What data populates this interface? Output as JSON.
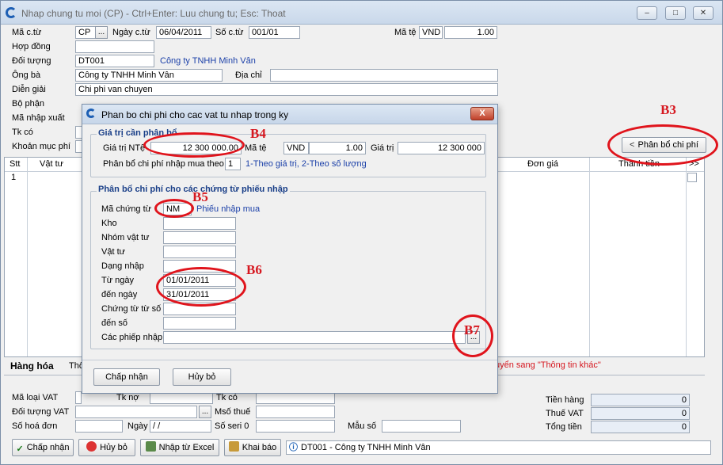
{
  "window": {
    "title": "Nhap chung tu moi (CP) - Ctrl+Enter: Luu chung tu; Esc: Thoat",
    "min": "–",
    "max": "□",
    "close": "✕"
  },
  "header": {
    "ma_ct_label": "Mã c.từ",
    "ma_ct_value": "CP",
    "ma_ct_btn": "...",
    "ngay_ct_label": "Ngày c.từ",
    "ngay_ct_value": "06/04/2011",
    "so_ct_label": "Số c.từ",
    "so_ct_value": "001/01",
    "ma_te_label": "Mã tệ",
    "ma_te_value": "VND",
    "ty_gia": "1.00",
    "hop_dong_label": "Hợp đồng",
    "doi_tuong_label": "Đối tượng",
    "doi_tuong_value": "DT001",
    "doi_tuong_name": "Công ty TNHH Minh Vân",
    "ong_ba_label": "Ông bà",
    "ong_ba_value": "Công ty TNHH Minh Vân",
    "dia_chi_label": "Địa chỉ",
    "dien_giai_label": "Diễn giải",
    "dien_giai_value": "Chi phi van chuyen",
    "bo_phan_label": "Bộ phận",
    "ma_nhap_xuat_label": "Mã nhập xuất",
    "tk_co_label": "Tk có",
    "khoan_muc_label": "Khoản mục phí",
    "phan_bo_btn": "Phân bổ chi phí"
  },
  "grid": {
    "columns": [
      "Stt",
      "Vật tư",
      "Đơn giá",
      "Thành tiền",
      ">>"
    ],
    "rows": [
      {
        "stt": "1"
      }
    ]
  },
  "tabs": {
    "hang_hoa": "Hàng hóa",
    "tab2": "Thô",
    "note": "uyển sang \"Thông tin khác\""
  },
  "vat": {
    "ma_loai_vat": "Mã loại VAT",
    "tk_no": "Tk nợ",
    "tk_co": "Tk có",
    "doi_tuong_vat": "Đối tượng VAT",
    "ms_thue": "Msố thuế",
    "btn": "...",
    "so_hoa_don": "Số hoá đơn",
    "ngay": "Ngày",
    "ngay_value": " / /",
    "so_seri": "Số seri 0",
    "mau_so": "Mẫu số"
  },
  "totals": {
    "tien_hang_label": "Tiền hàng",
    "tien_hang": "0",
    "thue_vat_label": "Thuế VAT",
    "thue_vat": "0",
    "tong_tien_label": "Tổng tiền",
    "tong_tien": "0"
  },
  "bottom": {
    "chap_nhan": "Chấp nhận",
    "huy_bo": "Hủy bỏ",
    "nhap_excel": "Nhập từ Excel",
    "khai_bao": "Khai báo",
    "status": "DT001 - Công ty TNHH Minh Vân"
  },
  "dialog": {
    "title": "Phan bo chi phi cho cac vat tu nhap trong ky",
    "close": "X",
    "group1_title": "Giá trị cần phân bổ",
    "gia_tri_nte_label": "Giá trị NTệ",
    "gia_tri_nte": "12 300 000.00",
    "ma_te_label": "Mã tệ",
    "ma_te": "VND",
    "ty_gia": "1.00",
    "gia_tri_label": "Giá trị",
    "gia_tri": "12 300 000",
    "phan_bo_theo_label": "Phân bổ chi phí nhập mua theo",
    "phan_bo_theo_value": "1",
    "phan_bo_theo_hint": "1-Theo giá trị,  2-Theo số lượng",
    "group2_title": "Phân bổ chi phí cho các chứng từ phiếu nhập",
    "ma_ct_label": "Mã chứng từ",
    "ma_ct": "NM",
    "ma_ct_name": "Phiếu nhập mua",
    "kho_label": "Kho",
    "nhom_vt_label": "Nhóm vật tư",
    "vat_tu_label": "Vật tư",
    "dang_nhap_label": "Dạng nhập",
    "tu_ngay_label": "Từ ngày",
    "tu_ngay": "01/01/2011",
    "den_ngay_label": "đến ngày",
    "den_ngay": "31/01/2011",
    "ct_tu_so_label": "Chứng từ từ số",
    "den_so_label": "đến số",
    "cac_phieu_label": "Các phiếp nhập",
    "cac_phieu_btn": "...",
    "chap_nhan": "Chấp nhận",
    "huy_bo": "Hủy bỏ"
  },
  "annotations": {
    "b3": "B3",
    "b4": "B4",
    "b5": "B5",
    "b6": "B6",
    "b7": "B7"
  },
  "colors": {
    "annotation": "#e0141c",
    "link_blue": "#1a3fa8",
    "group_title": "#1a3f88"
  }
}
